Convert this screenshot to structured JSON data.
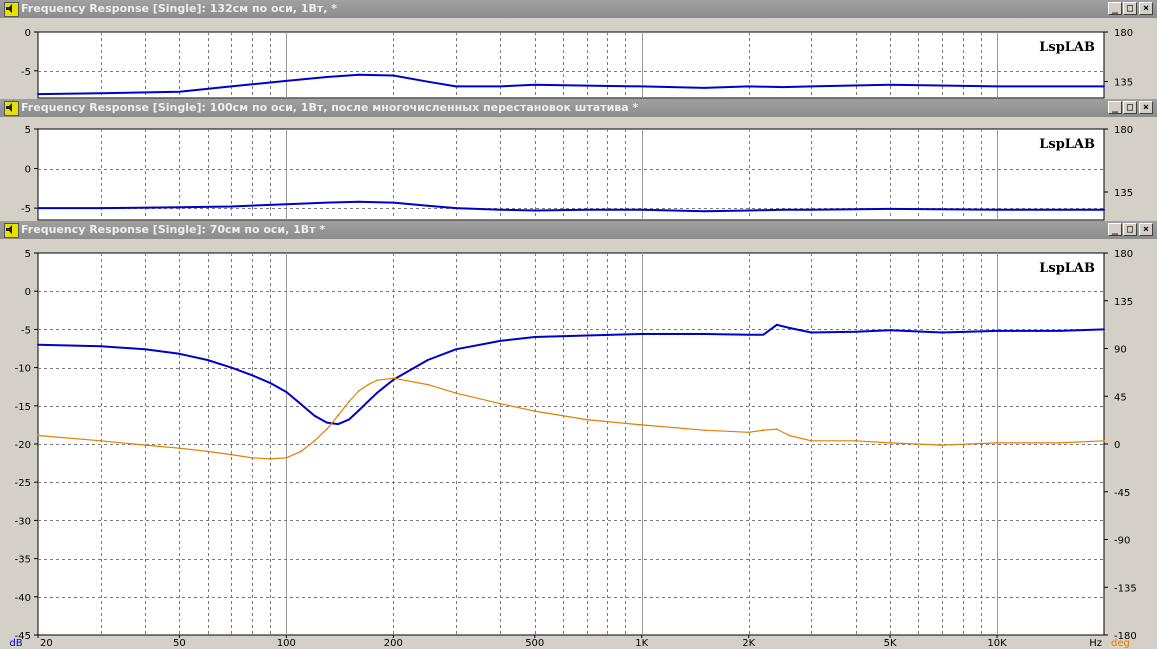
{
  "windows": [
    {
      "title": "Frequency Response [Single]: 132см по оси, 1Вт,  *",
      "logo": "LspLAB",
      "left_ticks": [
        "0",
        "-5"
      ],
      "right_ticks": [
        "180",
        "135"
      ]
    },
    {
      "title": "Frequency Response [Single]: 100см по оси, 1Вт, после многочисленных перестановок штатива *",
      "logo": "LspLAB",
      "left_ticks": [
        "5",
        "0",
        "-5"
      ],
      "right_ticks": [
        "180",
        "135"
      ]
    },
    {
      "title": "Frequency Response [Single]: 70см по оси, 1Вт *",
      "logo": "LspLAB",
      "left_ticks": [
        "5",
        "0",
        "-5",
        "-10",
        "-15",
        "-20",
        "-25",
        "-30",
        "-35",
        "-40",
        "-45"
      ],
      "right_ticks": [
        "180",
        "135",
        "90",
        "45",
        "0",
        "-45",
        "-90",
        "-135",
        "-180"
      ],
      "x_ticks": [
        "20",
        "50",
        "100",
        "200",
        "500",
        "1K",
        "2K",
        "5K",
        "10K"
      ],
      "x_unit": "Hz",
      "y_unit": "dB",
      "y2_unit": "deg"
    }
  ],
  "buttons": {
    "minimize": "_",
    "maximize": "□",
    "close": "×"
  },
  "colors": {
    "magnitude": "#0000c8",
    "phase": "#e08000",
    "grid": "#7a7a7a",
    "background": "#ffffff",
    "title_bar": "#8c8c8c"
  },
  "chart_data": [
    {
      "type": "line",
      "title": "Frequency Response [Single]: 132см по оси, 1Вт,  *",
      "xscale": "log",
      "xlim": [
        20,
        20000
      ],
      "ylim": [
        -8.5,
        0
      ],
      "y2lim": [
        120,
        180
      ],
      "x": [
        20,
        30,
        50,
        70,
        100,
        130,
        160,
        200,
        250,
        300,
        400,
        500,
        700,
        1000,
        1500,
        2000,
        2500,
        3000,
        5000,
        10000,
        20000
      ],
      "series": [
        {
          "values": [
            -8.0,
            -7.9,
            -7.7,
            -7.0,
            -6.3,
            -5.8,
            -5.5,
            -5.6,
            -6.4,
            -7.0,
            -7.0,
            -6.8,
            -6.9,
            -7.0,
            -7.2,
            -7.0,
            -7.1,
            -7.0,
            -6.8,
            -7.0,
            -7.0
          ]
        }
      ]
    },
    {
      "type": "line",
      "title": "Frequency Response [Single]: 100см по оси, 1Вт, после многочисленных перестановок штатива *",
      "xscale": "log",
      "xlim": [
        20,
        20000
      ],
      "ylim": [
        -6.5,
        5
      ],
      "y2lim": [
        115,
        180
      ],
      "x": [
        20,
        30,
        50,
        70,
        100,
        130,
        160,
        200,
        250,
        300,
        400,
        500,
        700,
        1000,
        1500,
        2000,
        2500,
        3000,
        5000,
        10000,
        20000
      ],
      "series": [
        {
          "values": [
            -5.0,
            -5.0,
            -4.9,
            -4.8,
            -4.5,
            -4.3,
            -4.2,
            -4.3,
            -4.7,
            -5.0,
            -5.2,
            -5.3,
            -5.2,
            -5.2,
            -5.4,
            -5.3,
            -5.2,
            -5.2,
            -5.1,
            -5.2,
            -5.2
          ]
        }
      ]
    },
    {
      "type": "line",
      "title": "Frequency Response [Single]: 70см по оси, 1Вт *",
      "xscale": "log",
      "xlim": [
        20,
        20000
      ],
      "ylim": [
        -45,
        5
      ],
      "y2lim": [
        -180,
        180
      ],
      "xlabel": "Hz",
      "ylabel": "dB",
      "y2label": "deg",
      "grid": true,
      "x": [
        20,
        30,
        40,
        50,
        60,
        70,
        80,
        90,
        100,
        110,
        120,
        130,
        140,
        150,
        160,
        170,
        180,
        200,
        250,
        300,
        400,
        500,
        700,
        1000,
        1500,
        2000,
        2200,
        2400,
        2600,
        3000,
        4000,
        5000,
        7000,
        10000,
        15000,
        20000
      ],
      "series": [
        {
          "name": "dB",
          "axis": "left",
          "values": [
            -7.0,
            -7.2,
            -7.6,
            -8.2,
            -9.0,
            -10.0,
            -11.0,
            -12.0,
            -13.2,
            -14.8,
            -16.3,
            -17.2,
            -17.4,
            -16.8,
            -15.6,
            -14.4,
            -13.3,
            -11.6,
            -9.0,
            -7.6,
            -6.5,
            -6.0,
            -5.8,
            -5.6,
            -5.6,
            -5.7,
            -5.7,
            -4.4,
            -4.8,
            -5.4,
            -5.3,
            -5.1,
            -5.4,
            -5.2,
            -5.2,
            -5.0
          ]
        },
        {
          "name": "deg",
          "axis": "right",
          "values": [
            8,
            3,
            -1,
            -4,
            -7,
            -10,
            -13,
            -14,
            -13,
            -7,
            3,
            14,
            27,
            40,
            50,
            56,
            60,
            62,
            56,
            48,
            38,
            31,
            23,
            18,
            13,
            11,
            13,
            14,
            8,
            3,
            3,
            1,
            -1,
            1,
            1,
            3
          ]
        }
      ]
    }
  ]
}
